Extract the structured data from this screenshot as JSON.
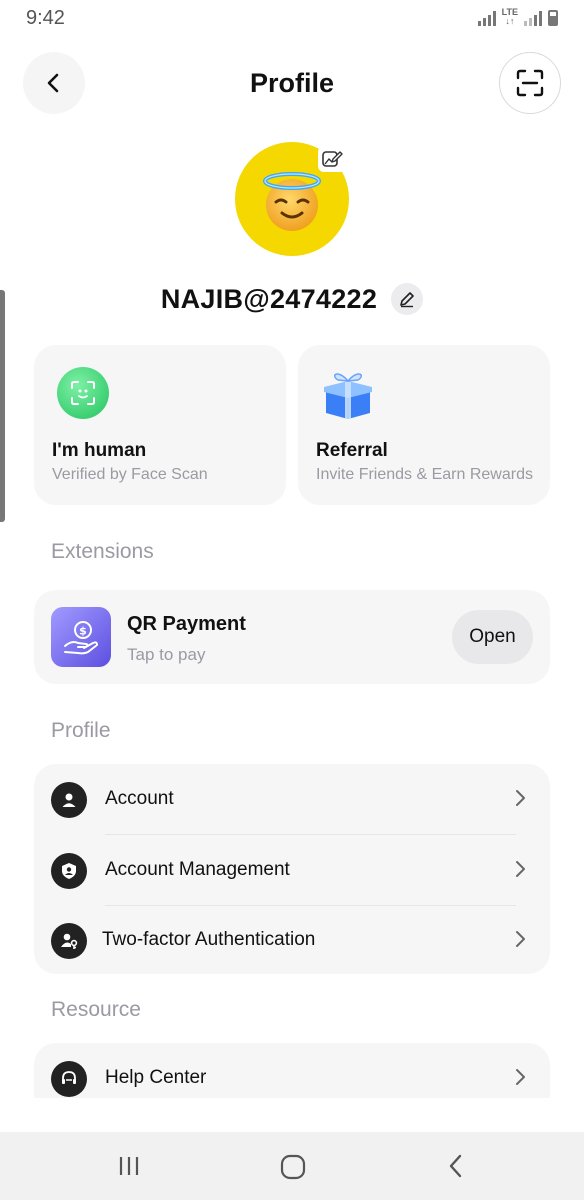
{
  "status_bar": {
    "time": "9:42",
    "network": "LTE"
  },
  "header": {
    "title": "Profile"
  },
  "user": {
    "username": "NAJIB@2474222"
  },
  "cards": {
    "human": {
      "title": "I'm human",
      "subtitle": "Verified by Face Scan"
    },
    "referral": {
      "title": "Referral",
      "subtitle": "Invite Friends & Earn Rewards"
    }
  },
  "extensions": {
    "section_label": "Extensions",
    "qr_payment": {
      "title": "QR Payment",
      "subtitle": "Tap to pay",
      "action_label": "Open"
    }
  },
  "profile": {
    "section_label": "Profile",
    "items": [
      {
        "label": "Account",
        "icon": "user-icon"
      },
      {
        "label": "Account Management",
        "icon": "account-shield-icon"
      },
      {
        "label": "Two-factor Authentication",
        "icon": "user-key-icon"
      }
    ]
  },
  "resource": {
    "section_label": "Resource",
    "items": [
      {
        "label": "Help Center",
        "icon": "headset-icon"
      }
    ]
  },
  "colors": {
    "avatar_bg": "#f5d800",
    "card_bg": "#f6f6f7",
    "qr_gradient_start": "#a29bff",
    "qr_gradient_end": "#5d4fe0",
    "face_scan_green": "#22c35e"
  }
}
